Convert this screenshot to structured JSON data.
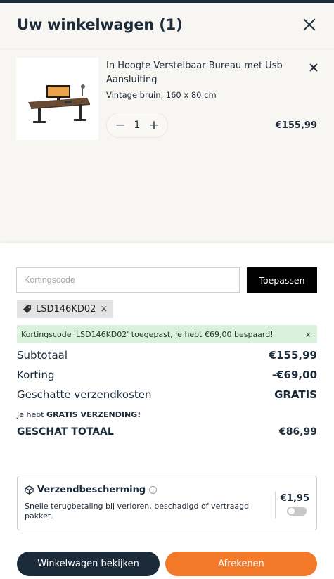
{
  "header": {
    "title": "Uw winkelwagen (1)"
  },
  "item": {
    "name": "In Hoogte Verstelbaar Bureau met Usb Aansluiting",
    "variant": "Vintage bruin, 160 x 80 cm",
    "quantity": "1",
    "price": "€155,99",
    "minus_glyph": "−",
    "plus_glyph": "+"
  },
  "coupon": {
    "placeholder": "Kortingscode",
    "apply_label": "Toepassen",
    "applied_code": "LSD146KD02",
    "tag_remove_glyph": "×",
    "success_message": "Kortingscode 'LSD146KD02' toegepast, je hebt €69,00 bespaard!",
    "success_close_glyph": "×"
  },
  "summary": {
    "subtotal_label": "Subtotaal",
    "subtotal_value": "€155,99",
    "discount_label": "Korting",
    "discount_value": "-€69,00",
    "shipping_label": "Geschatte verzendkosten",
    "shipping_value": "GRATIS",
    "free_note_prefix": "Je hebt ",
    "free_note_bold": "GRATIS VERZENDING!",
    "total_label": "GESCHAT TOTAAL",
    "total_value": "€86,99"
  },
  "protection": {
    "title": "Verzendbescherming",
    "info_glyph": "i",
    "description": "Snelle terugbetaling bij verloren, beschadigd of vertraagd pakket.",
    "price": "€1,95",
    "enabled": false
  },
  "actions": {
    "view_cart_label": "Winkelwagen bekijken",
    "checkout_label": "Afrekenen"
  },
  "colors": {
    "navy": "#1c2b3a",
    "orange": "#f47a2b",
    "success_bg": "#d9f1dd"
  }
}
